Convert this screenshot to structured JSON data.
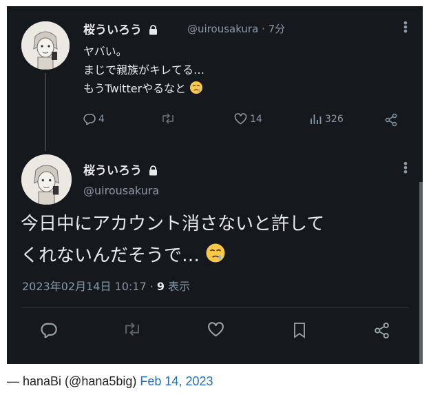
{
  "tweet": {
    "display_name": "桜ういろう",
    "handle": "@uirousakura",
    "time_suffix": "· 7分",
    "lines": [
      "ヤバい。",
      "まじで親族がキレてる…",
      "もうTwitterやるなと"
    ],
    "counts": {
      "replies": "4",
      "likes": "14",
      "views": "326"
    }
  },
  "reply": {
    "display_name": "桜ういろう",
    "handle": "@uirousakura",
    "lines": [
      "今日中にアカウント消さないと許して",
      "くれないんだそうで…"
    ],
    "timestamp": "2023年02月14日 10:17 ·",
    "view_count": "9",
    "view_label": "表示"
  },
  "caption": {
    "prefix": "— hanaBi (@hana5big)",
    "date_link": "Feb 14, 2023"
  },
  "colors": {
    "background": "#15181d",
    "text": "#e7e9ea",
    "muted": "#8b98a5",
    "link": "#1d6fc0"
  },
  "icons": [
    "lock-icon",
    "more-icon",
    "reply-icon",
    "retweet-icon",
    "like-icon",
    "views-icon",
    "share-icon",
    "bookmark-icon",
    "crying-emoji"
  ]
}
